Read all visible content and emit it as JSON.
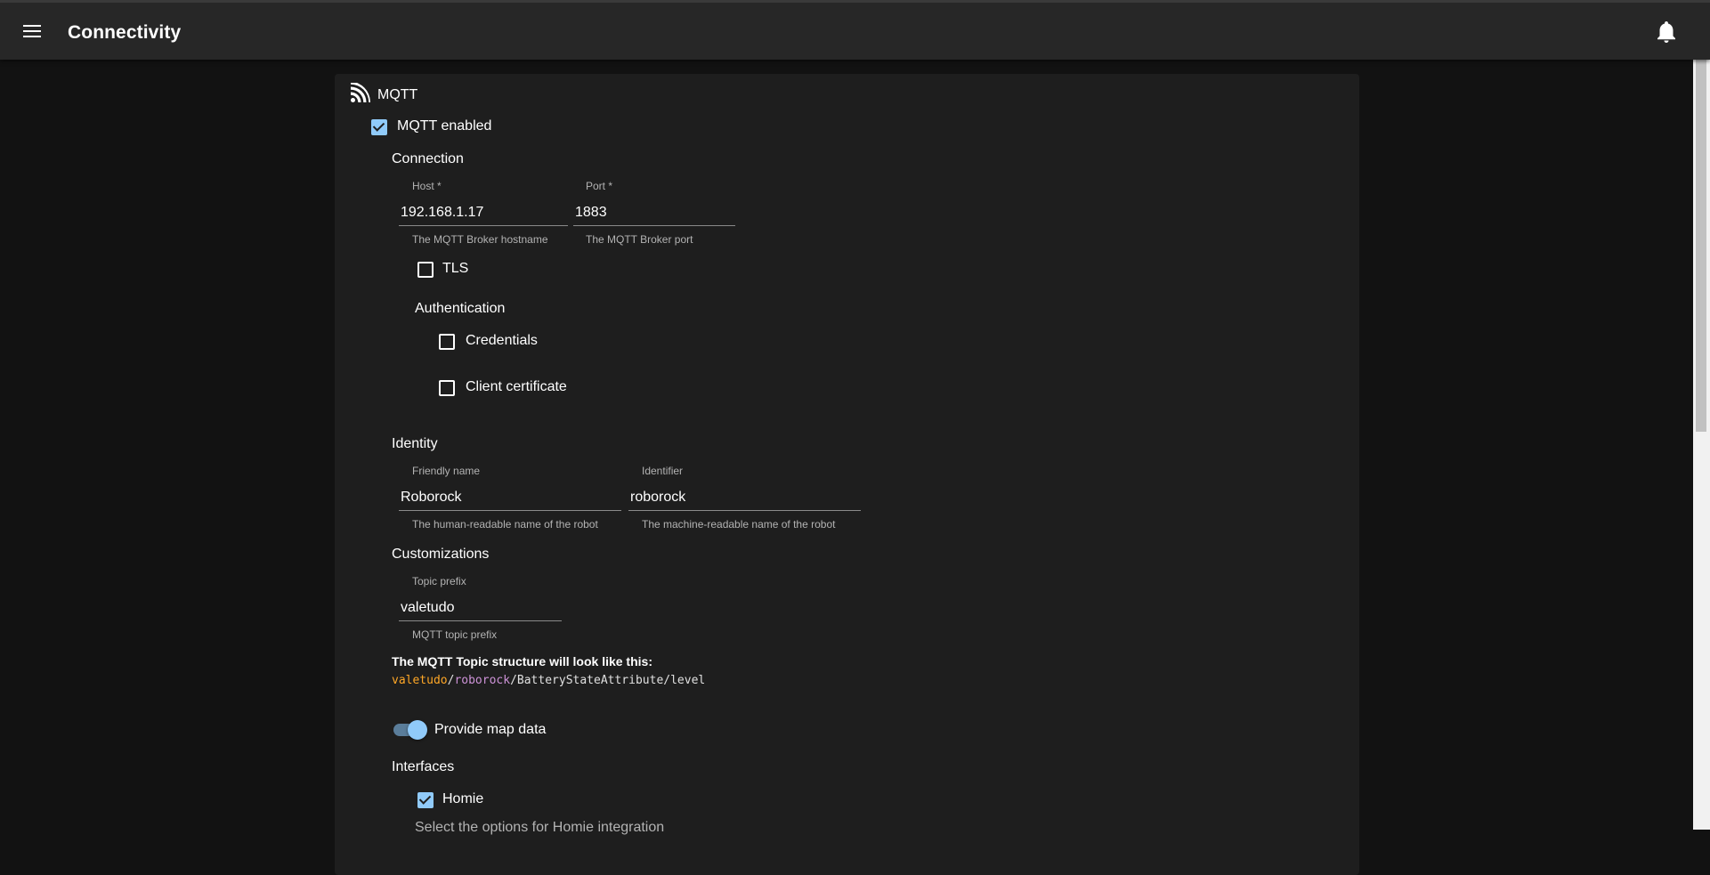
{
  "appbar": {
    "title": "Connectivity"
  },
  "card": {
    "title": "MQTT",
    "enabled_label": "MQTT enabled",
    "connection": {
      "heading": "Connection",
      "host": {
        "label": "Host *",
        "value": "192.168.1.17",
        "helper": "The MQTT Broker hostname"
      },
      "port": {
        "label": "Port *",
        "value": "1883",
        "helper": "The MQTT Broker port"
      },
      "tls_label": "TLS",
      "authentication": {
        "heading": "Authentication",
        "credentials_label": "Credentials",
        "client_certificate_label": "Client certificate"
      }
    },
    "identity": {
      "heading": "Identity",
      "friendly_name": {
        "label": "Friendly name",
        "value": "Roborock",
        "helper": "The human-readable name of the robot"
      },
      "identifier": {
        "label": "Identifier",
        "value": "roborock",
        "helper": "The machine-readable name of the robot"
      }
    },
    "customizations": {
      "heading": "Customizations",
      "topic_prefix": {
        "label": "Topic prefix",
        "value": "valetudo",
        "helper": "MQTT topic prefix"
      },
      "topic_structure_title": "The MQTT Topic structure will look like this:",
      "topic_structure": {
        "prefix": "valetudo",
        "sep1": "/",
        "identifier": "roborock",
        "rest": "/BatteryStateAttribute/level"
      },
      "provide_map_label": "Provide map data"
    },
    "interfaces": {
      "heading": "Interfaces",
      "homie_label": "Homie",
      "homie_select_text": "Select the options for Homie integration"
    }
  },
  "colors": {
    "accent": "#90caf9",
    "topic_prefix": "#ffa726",
    "topic_identifier": "#ce93d8",
    "appbar": "#272727",
    "card": "#1e1e1e",
    "background": "#121212"
  },
  "icons": [
    "menu-icon",
    "bell-icon",
    "rss-feed-icon",
    "check-icon"
  ]
}
